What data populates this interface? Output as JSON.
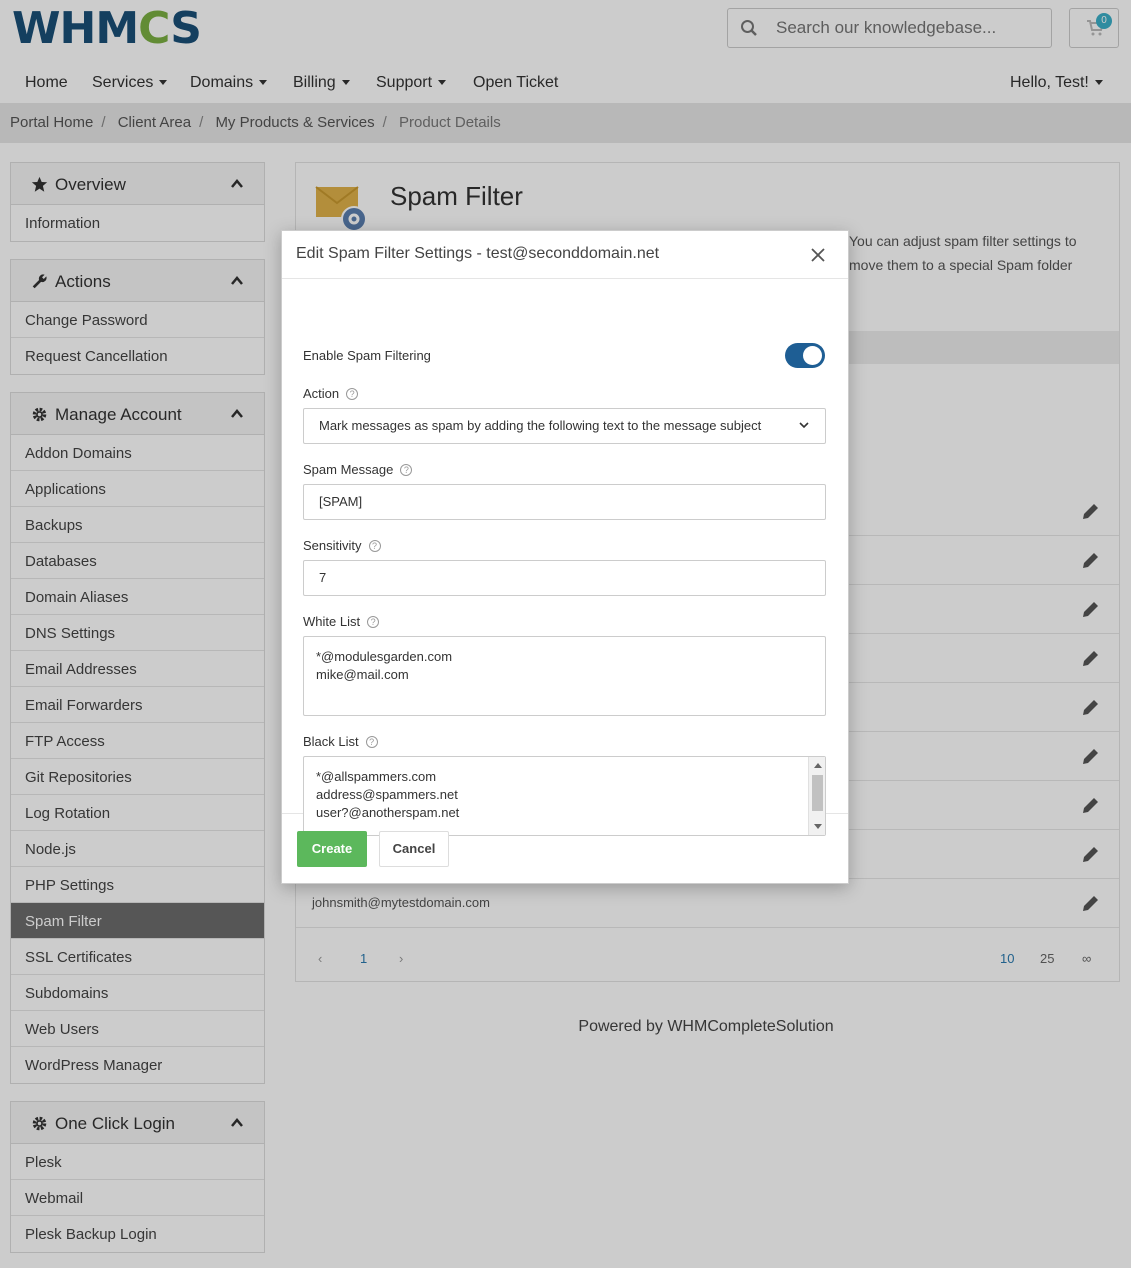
{
  "header": {
    "logo_text_a": "WHM",
    "logo_text_gear": "C",
    "logo_text_b": "S",
    "search_placeholder": "Search our knowledgebase...",
    "cart_count": "0"
  },
  "nav": {
    "items": [
      {
        "label": "Home"
      },
      {
        "label": "Services"
      },
      {
        "label": "Domains"
      },
      {
        "label": "Billing"
      },
      {
        "label": "Support"
      },
      {
        "label": "Open Ticket"
      }
    ],
    "user_label": "Hello, Test!"
  },
  "breadcrumb": [
    "Portal Home",
    "Client Area",
    "My Products & Services",
    "Product Details"
  ],
  "sidebar": {
    "overview": {
      "title": "Overview",
      "items": [
        "Information"
      ]
    },
    "actions": {
      "title": "Actions",
      "items": [
        "Change Password",
        "Request Cancellation"
      ]
    },
    "manage": {
      "title": "Manage Account",
      "items": [
        "Addon Domains",
        "Applications",
        "Backups",
        "Databases",
        "Domain Aliases",
        "DNS Settings",
        "Email Addresses",
        "Email Forwarders",
        "FTP Access",
        "Git Repositories",
        "Log Rotation",
        "Node.js",
        "PHP Settings",
        "Spam Filter",
        "SSL Certificates",
        "Subdomains",
        "Web Users",
        "WordPress Manager"
      ],
      "active": "Spam Filter"
    },
    "oneclick": {
      "title": "One Click Login",
      "items": [
        "Plesk",
        "Webmail",
        "Plesk Backup Login"
      ]
    }
  },
  "main": {
    "title": "Spam Filter",
    "description_line1": "You can adjust spam filter settings to",
    "description_line2": "move them to a special Spam folder",
    "last_row_email": "johnsmith@mytestdomain.com",
    "pager": {
      "page": "1",
      "sizes": [
        "10",
        "25",
        "∞"
      ]
    }
  },
  "footer": {
    "text": "Powered by WHMCompleteSolution"
  },
  "modal": {
    "title": "Edit Spam Filter Settings - test@seconddomain.net",
    "enable_label": "Enable Spam Filtering",
    "enable_on": true,
    "action_label": "Action",
    "action_value": "Mark messages as spam by adding the following text to the message subject",
    "spam_message_label": "Spam Message",
    "spam_message_value": "[SPAM]",
    "sensitivity_label": "Sensitivity",
    "sensitivity_value": "7",
    "whitelist_label": "White List",
    "whitelist": [
      "*@modulesgarden.com",
      "mike@mail.com"
    ],
    "blacklist_label": "Black List",
    "blacklist": [
      "*@allspammers.com",
      "address@spammers.net",
      "user?@anotherspam.net"
    ],
    "create_label": "Create",
    "cancel_label": "Cancel"
  },
  "colors": {
    "accent": "#1e5e94",
    "success": "#5cb85c",
    "active_item": "#6c6c6c"
  }
}
